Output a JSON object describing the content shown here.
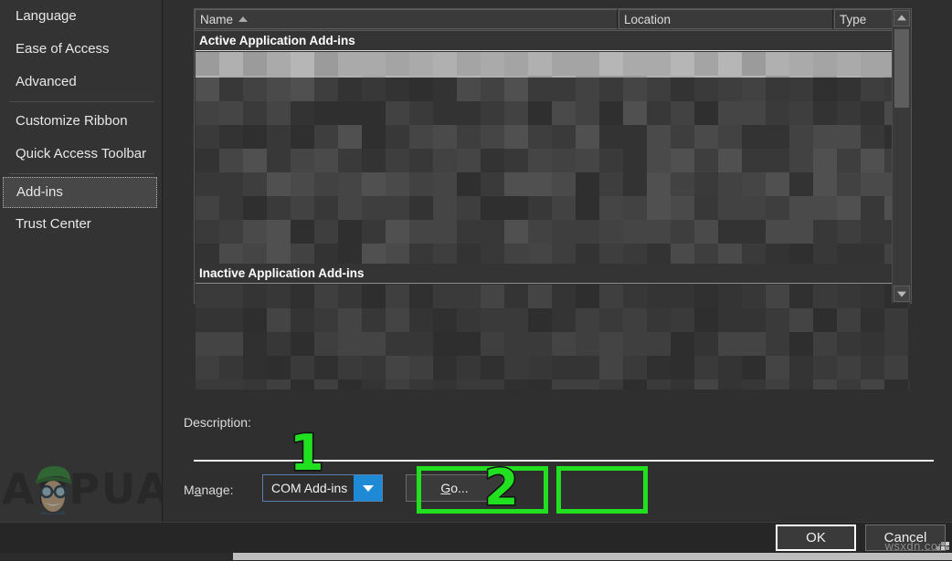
{
  "sidebar": {
    "items": [
      {
        "label": "Language",
        "selected": false,
        "separator_after": false
      },
      {
        "label": "Ease of Access",
        "selected": false,
        "separator_after": false
      },
      {
        "label": "Advanced",
        "selected": false,
        "separator_after": true
      },
      {
        "label": "Customize Ribbon",
        "selected": false,
        "separator_after": false
      },
      {
        "label": "Quick Access Toolbar",
        "selected": false,
        "separator_after": true
      },
      {
        "label": "Add-ins",
        "selected": true,
        "separator_after": false
      },
      {
        "label": "Trust Center",
        "selected": false,
        "separator_after": false
      }
    ]
  },
  "addins_list": {
    "columns": [
      {
        "label": "Name",
        "sorted": "ascending",
        "sort_icon": "sort-ascending-triangle-icon"
      },
      {
        "label": "Location",
        "sorted": "none",
        "sort_icon": ""
      },
      {
        "label": "Type",
        "sorted": "none",
        "sort_icon": ""
      }
    ],
    "groups": [
      {
        "label": "Active Application Add-ins",
        "rows_censored": true
      },
      {
        "label": "Inactive Application Add-ins",
        "rows_censored": true
      }
    ],
    "scrollbar": {
      "up_icon": "scroll-up-arrow-icon",
      "down_icon": "scroll-down-arrow-icon",
      "orientation": "vertical"
    }
  },
  "description": {
    "label": "Description:",
    "value": ""
  },
  "manage": {
    "label_prefix": "M",
    "label_accel": "a",
    "label_suffix": "nage:",
    "combo_value": "COM Add-ins",
    "combo_arrow_icon": "chevron-down-icon",
    "go_prefix": "",
    "go_accel": "G",
    "go_suffix": "o...",
    "go_label": "Go..."
  },
  "annotations": [
    {
      "number": "1",
      "target": "manage-combo"
    },
    {
      "number": "2",
      "target": "go-button"
    }
  ],
  "dialog_buttons": {
    "ok": "OK",
    "cancel": "Cancel"
  },
  "watermarks": {
    "brand": "APPUALS",
    "site": "wsxdn.com",
    "mascot_icon": "appuals-mascot-icon"
  },
  "colors": {
    "accent_blue": "#1e8ad6",
    "annotation_green": "#20e020",
    "panel_bg": "#2f2f2f",
    "sidebar_bg": "#333333",
    "selected_row": "#a8a8a8",
    "text": "#e6e6e6"
  }
}
